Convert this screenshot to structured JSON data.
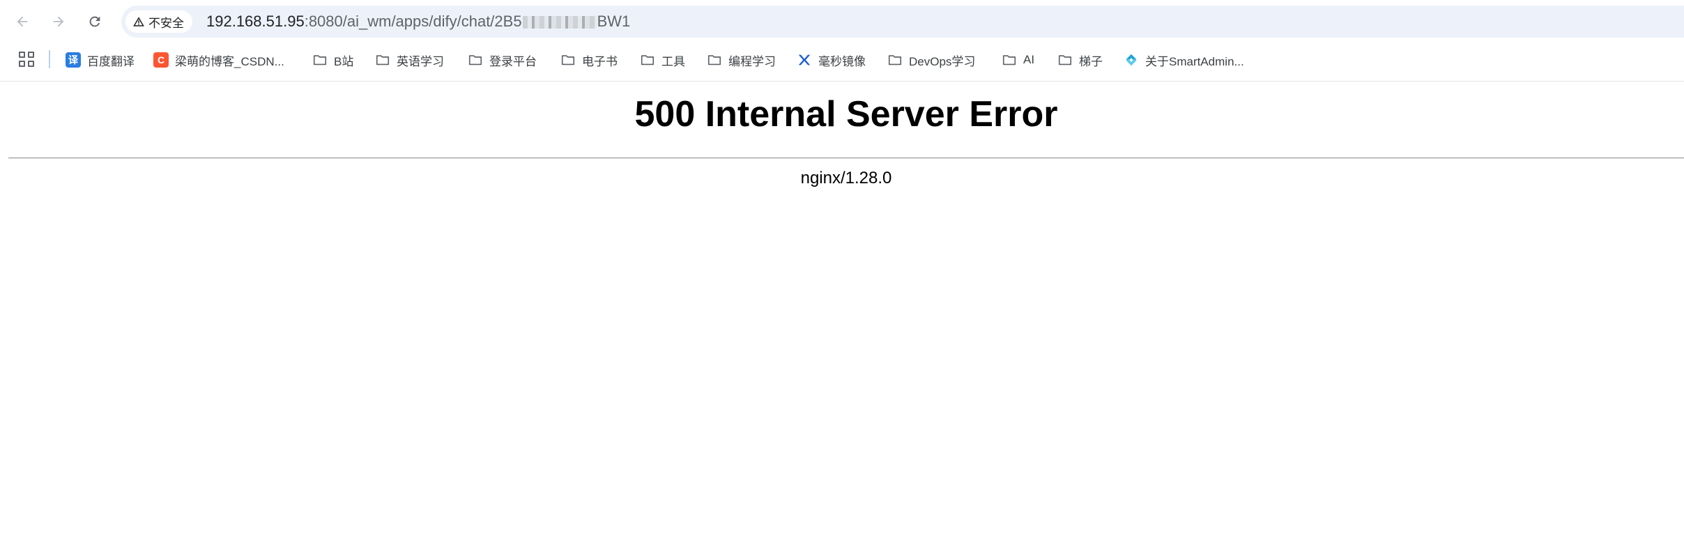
{
  "browser": {
    "security_label": "不安全",
    "url_host": "192.168.51.95",
    "url_path_prefix": ":8080/ai_wm/apps/dify/chat/2B5",
    "url_path_suffix": "BW1"
  },
  "bookmarks": [
    {
      "label": "百度翻译",
      "icon": "baidu-translate-icon",
      "color": "#2a7de1",
      "glyph": "译"
    },
    {
      "label": "梁萌的博客_CSDN...",
      "icon": "csdn-icon",
      "color": "#fc5531",
      "glyph": "C"
    },
    {
      "label": "B站",
      "icon": "folder-icon"
    },
    {
      "label": "英语学习",
      "icon": "folder-icon"
    },
    {
      "label": "登录平台",
      "icon": "folder-icon"
    },
    {
      "label": "电子书",
      "icon": "folder-icon"
    },
    {
      "label": "工具",
      "icon": "folder-icon"
    },
    {
      "label": "编程学习",
      "icon": "folder-icon"
    },
    {
      "label": "毫秒镜像",
      "icon": "millisecond-mirror-icon",
      "color": "#1a5fd0"
    },
    {
      "label": "DevOps学习",
      "icon": "folder-icon"
    },
    {
      "label": "AI",
      "icon": "folder-icon"
    },
    {
      "label": "梯子",
      "icon": "folder-icon"
    },
    {
      "label": "关于SmartAdmin...",
      "icon": "smartadmin-icon",
      "color": "#1aa3d9"
    }
  ],
  "page": {
    "title": "500 Internal Server Error",
    "server_signature": "nginx/1.28.0"
  }
}
